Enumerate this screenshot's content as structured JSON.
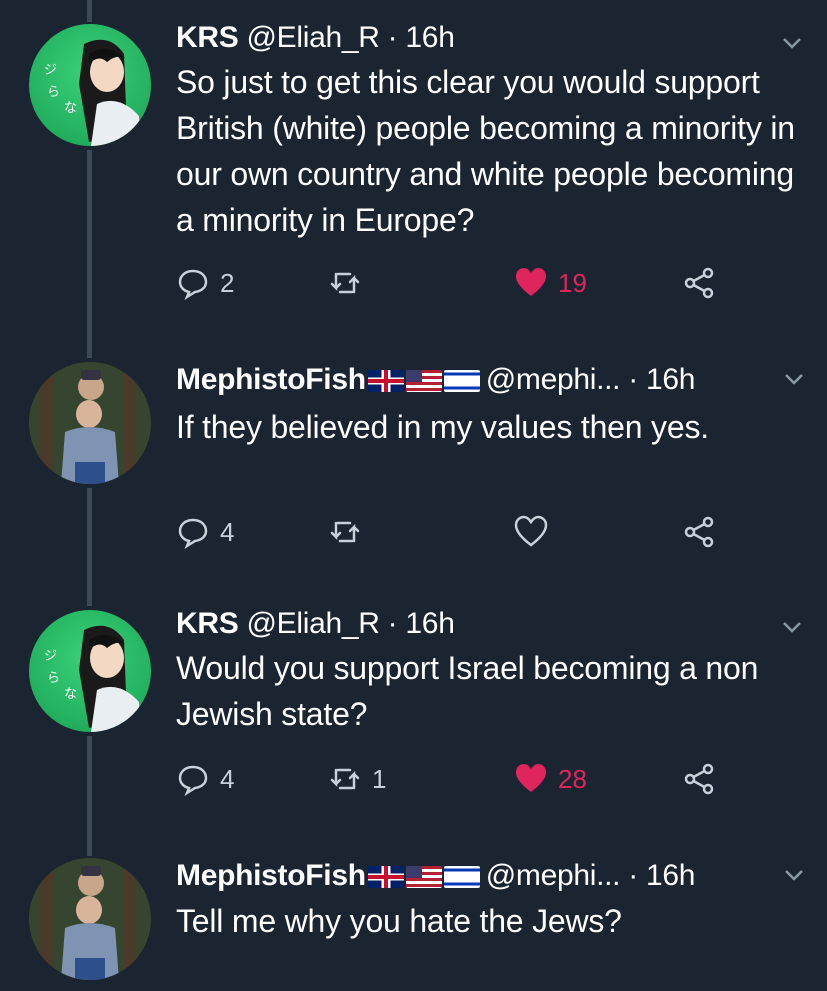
{
  "tweets": [
    {
      "name": "KRS",
      "handle": "@Eliah_R",
      "separator": "·",
      "time": "16h",
      "text": "So just to get this clear you would support British (white) people becoming a minority in our own country and white people becoming a minority in Europe?",
      "replies": "2",
      "retweets": "",
      "likes": "19",
      "liked": true
    },
    {
      "name": "MephistoFish",
      "flags": [
        "uk-flag",
        "us-flag",
        "israel-flag"
      ],
      "handle": "@mephi...",
      "separator": "·",
      "time": "16h",
      "text": "If they believed in my values then yes.",
      "replies": "4",
      "retweets": "",
      "likes": "",
      "liked": false
    },
    {
      "name": "KRS",
      "handle": "@Eliah_R",
      "separator": "·",
      "time": "16h",
      "text": "Would you support Israel becoming a non Jewish state?",
      "replies": "4",
      "retweets": "1",
      "likes": "28",
      "liked": true
    },
    {
      "name": "MephistoFish",
      "flags": [
        "uk-flag",
        "us-flag",
        "israel-flag"
      ],
      "handle": "@mephi...",
      "separator": "·",
      "time": "16h",
      "text": "Tell me why you hate the Jews?"
    }
  ],
  "colors": {
    "background": "#1b2431",
    "like_red": "#e0245e",
    "icon_gray": "#c8d0da",
    "thread_line": "#3d4a5a"
  }
}
